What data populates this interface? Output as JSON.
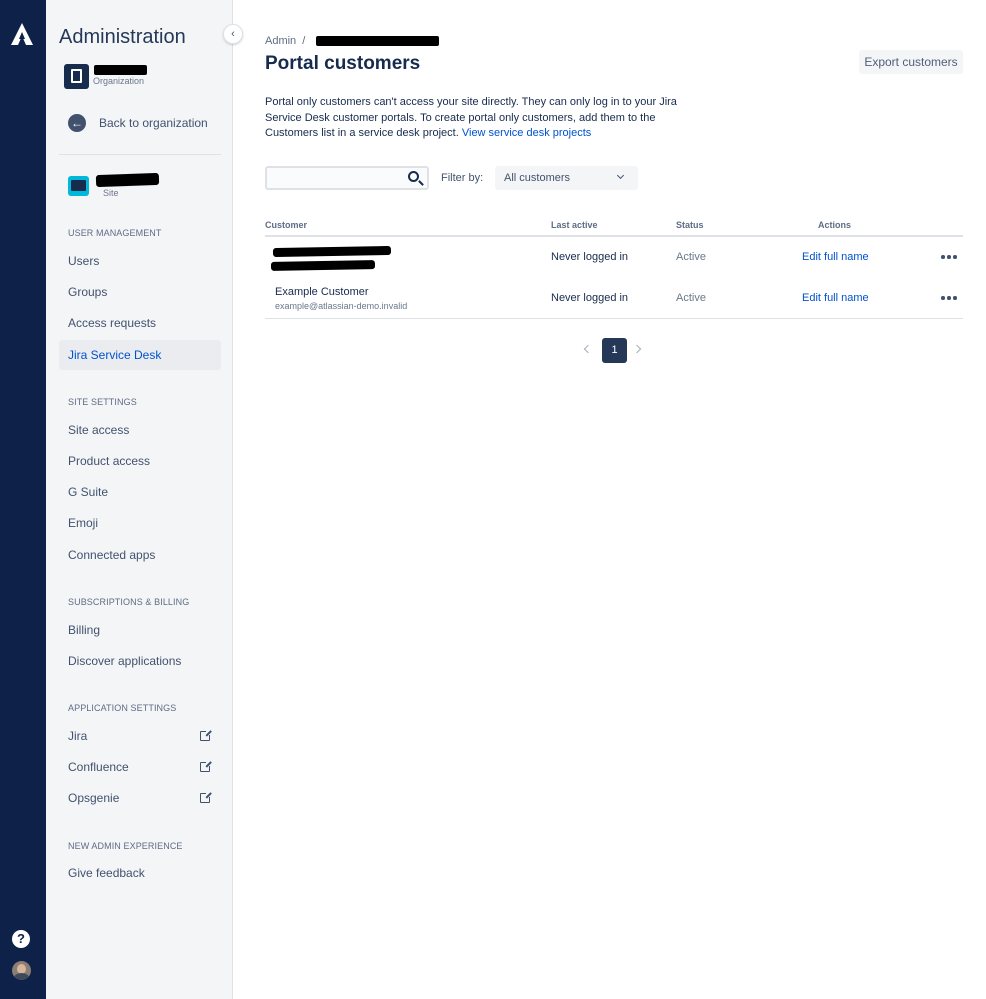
{
  "sidebar": {
    "title": "Administration",
    "org_sub": "Organization",
    "back_label": "Back to organization",
    "site_sub": "Site",
    "sections": {
      "user_management": "USER MANAGEMENT",
      "site_settings": "SITE SETTINGS",
      "subscriptions": "SUBSCRIPTIONS & BILLING",
      "application_settings": "APPLICATION SETTINGS",
      "new_admin": "NEW ADMIN EXPERIENCE"
    },
    "items": {
      "users": "Users",
      "groups": "Groups",
      "access_requests": "Access requests",
      "jira_service_desk": "Jira Service Desk",
      "site_access": "Site access",
      "product_access": "Product access",
      "g_suite": "G Suite",
      "emoji": "Emoji",
      "connected_apps": "Connected apps",
      "billing": "Billing",
      "discover_applications": "Discover applications",
      "jira": "Jira",
      "confluence": "Confluence",
      "opsgenie": "Opsgenie",
      "give_feedback": "Give feedback"
    },
    "active_item": "jira_service_desk"
  },
  "rail": {
    "logo_icon": "atlassian-logo",
    "help_glyph": "?",
    "help_icon": "help-icon",
    "avatar_icon": "user-avatar"
  },
  "main": {
    "breadcrumb_root": "Admin",
    "breadcrumb_sep": "/",
    "title": "Portal customers",
    "export_button": "Export customers",
    "description": "Portal only customers can't access your site directly. They can only log in to your Jira Service Desk customer portals. To create portal only customers, add them to the Customers list in a service desk project.",
    "description_link": "View service desk projects",
    "search_placeholder": "",
    "filter_label": "Filter by:",
    "filter_value": "All customers",
    "columns": {
      "customer": "Customer",
      "last_active": "Last active",
      "status": "Status",
      "actions": "Actions"
    },
    "rows": [
      {
        "name": "",
        "email": "",
        "last_active": "Never logged in",
        "status": "Active",
        "action": "Edit full name"
      },
      {
        "name": "Example Customer",
        "email": "example@atlassian-demo.invalid",
        "last_active": "Never logged in",
        "status": "Active",
        "action": "Edit full name"
      }
    ],
    "pagination": {
      "current": "1"
    }
  },
  "colors": {
    "rail": "#0E2148",
    "sidebar_bg": "#F4F5F7",
    "link": "#0052CC",
    "text": "#172B4D",
    "page_current": "#253858"
  }
}
